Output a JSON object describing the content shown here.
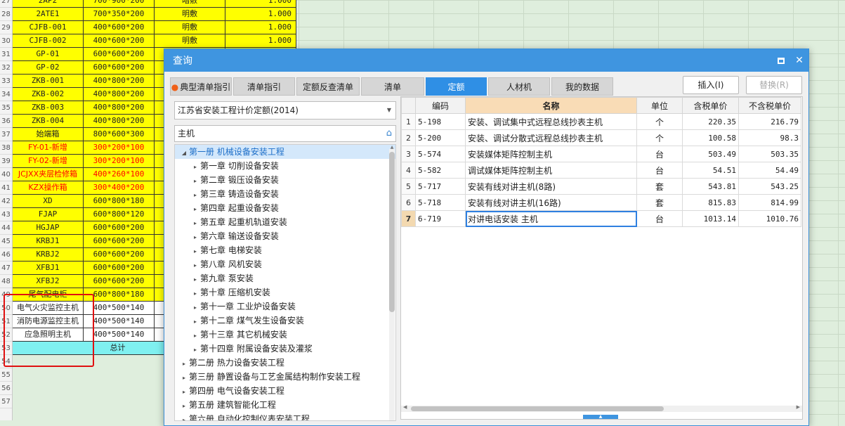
{
  "spreadsheet": {
    "row_numbers": [
      "27",
      "28",
      "29",
      "30",
      "31",
      "32",
      "33",
      "34",
      "35",
      "36",
      "37",
      "38",
      "39",
      "40",
      "41",
      "42",
      "43",
      "44",
      "45",
      "46",
      "47",
      "48",
      "49",
      "50",
      "51",
      "52",
      "53",
      "54",
      "55",
      "56",
      "57"
    ],
    "rows": [
      {
        "a": "2AP2",
        "b": "700*900*200",
        "c": "暗敷",
        "d": "1.000",
        "style": "yel"
      },
      {
        "a": "2ATE1",
        "b": "700*350*200",
        "c": "明敷",
        "d": "1.000",
        "style": "yel"
      },
      {
        "a": "CJFB-001",
        "b": "400*600*200",
        "c": "明敷",
        "d": "1.000",
        "style": "yel"
      },
      {
        "a": "CJFB-002",
        "b": "400*600*200",
        "c": "明敷",
        "d": "1.000",
        "style": "yel"
      },
      {
        "a": "GP-01",
        "b": "600*600*200",
        "c": "",
        "d": "",
        "style": "yel"
      },
      {
        "a": "GP-02",
        "b": "600*600*200",
        "c": "",
        "d": "",
        "style": "yel"
      },
      {
        "a": "ZKB-001",
        "b": "400*800*200",
        "c": "",
        "d": "",
        "style": "yel"
      },
      {
        "a": "ZKB-002",
        "b": "400*800*200",
        "c": "",
        "d": "",
        "style": "yel"
      },
      {
        "a": "ZKB-003",
        "b": "400*800*200",
        "c": "",
        "d": "",
        "style": "yel"
      },
      {
        "a": "ZKB-004",
        "b": "400*800*200",
        "c": "",
        "d": "",
        "style": "yel"
      },
      {
        "a": "始端箱",
        "b": "800*600*300",
        "c": "",
        "d": "",
        "style": "yel"
      },
      {
        "a": "FY-01-新增",
        "b": "300*200*100",
        "c": "",
        "d": "",
        "style": "yel red"
      },
      {
        "a": "FY-02-新增",
        "b": "300*200*100",
        "c": "",
        "d": "",
        "style": "yel red"
      },
      {
        "a": "JCJXX夹层检修箱",
        "b": "400*260*100",
        "c": "",
        "d": "",
        "style": "yel red"
      },
      {
        "a": "KZX操作箱",
        "b": "300*400*200",
        "c": "",
        "d": "",
        "style": "yel red"
      },
      {
        "a": "XD",
        "b": "600*800*180",
        "c": "",
        "d": "",
        "style": "yel"
      },
      {
        "a": "FJAP",
        "b": "600*800*120",
        "c": "",
        "d": "",
        "style": "yel"
      },
      {
        "a": "HGJAP",
        "b": "600*600*200",
        "c": "",
        "d": "",
        "style": "yel"
      },
      {
        "a": "KRBJ1",
        "b": "600*600*200",
        "c": "",
        "d": "",
        "style": "yel"
      },
      {
        "a": "KRBJ2",
        "b": "600*600*200",
        "c": "",
        "d": "",
        "style": "yel"
      },
      {
        "a": "XFBJ1",
        "b": "600*600*200",
        "c": "",
        "d": "",
        "style": "yel"
      },
      {
        "a": "XFBJ2",
        "b": "600*600*200",
        "c": "",
        "d": "",
        "style": "yel"
      },
      {
        "a": "尾气配电柜",
        "b": "600*800*180",
        "c": "",
        "d": "",
        "style": "yel"
      },
      {
        "a": "电气火灾监控主机",
        "b": "400*500*140",
        "c": "",
        "d": "",
        "style": "wht"
      },
      {
        "a": "消防电源监控主机",
        "b": "400*500*140",
        "c": "",
        "d": "",
        "style": "wht"
      },
      {
        "a": "应急照明主机",
        "b": "400*500*140",
        "c": "",
        "d": "",
        "style": "wht"
      }
    ],
    "total_label": "总计"
  },
  "dialog": {
    "title": "查询",
    "tabs": [
      {
        "label": "典型清单指引",
        "active": false
      },
      {
        "label": "清单指引",
        "active": false
      },
      {
        "label": "定额反查清单",
        "active": false
      },
      {
        "label": "清单",
        "active": false
      },
      {
        "label": "定额",
        "active": true
      },
      {
        "label": "人材机",
        "active": false
      },
      {
        "label": "我的数据",
        "active": false
      }
    ],
    "insert_label": "插入(I)",
    "replace_label": "替换(R)",
    "quota_selected": "江苏省安装工程计价定额(2014)",
    "search_value": "主机",
    "tree": [
      {
        "label": "第一册 机械设备安装工程",
        "level": 0,
        "expanded": true,
        "selected": true
      },
      {
        "label": "第一章 切削设备安装",
        "level": 1
      },
      {
        "label": "第二章 锻压设备安装",
        "level": 1
      },
      {
        "label": "第三章 铸造设备安装",
        "level": 1
      },
      {
        "label": "第四章 起重设备安装",
        "level": 1
      },
      {
        "label": "第五章 起重机轨道安装",
        "level": 1
      },
      {
        "label": "第六章 输送设备安装",
        "level": 1
      },
      {
        "label": "第七章 电梯安装",
        "level": 1
      },
      {
        "label": "第八章 风机安装",
        "level": 1
      },
      {
        "label": "第九章 泵安装",
        "level": 1
      },
      {
        "label": "第十章 压缩机安装",
        "level": 1
      },
      {
        "label": "第十一章 工业炉设备安装",
        "level": 1
      },
      {
        "label": "第十二章 煤气发生设备安装",
        "level": 1
      },
      {
        "label": "第十三章 其它机械安装",
        "level": 1
      },
      {
        "label": "第十四章 附属设备安装及灌浆",
        "level": 1
      },
      {
        "label": "第二册 热力设备安装工程",
        "level": 0
      },
      {
        "label": "第三册 静置设备与工艺金属结构制作安装工程",
        "level": 0
      },
      {
        "label": "第四册 电气设备安装工程",
        "level": 0
      },
      {
        "label": "第五册 建筑智能化工程",
        "level": 0
      },
      {
        "label": "第六册 自动化控制仪表安装工程",
        "level": 0
      }
    ],
    "grid": {
      "headers": {
        "code": "编码",
        "name": "名称",
        "unit": "单位",
        "tax_price": "含税单价",
        "notax_price": "不含税单价"
      },
      "rows": [
        {
          "idx": "1",
          "code": "5-198",
          "name": "安装、调试集中式远程总线抄表主机",
          "unit": "个",
          "tax_price": "220.35",
          "notax_price": "216.79"
        },
        {
          "idx": "2",
          "code": "5-200",
          "name": "安装、调试分散式远程总线抄表主机",
          "unit": "个",
          "tax_price": "100.58",
          "notax_price": "98.3"
        },
        {
          "idx": "3",
          "code": "5-574",
          "name": "安装媒体矩阵控制主机",
          "unit": "台",
          "tax_price": "503.49",
          "notax_price": "503.35"
        },
        {
          "idx": "4",
          "code": "5-582",
          "name": "调试媒体矩阵控制主机",
          "unit": "台",
          "tax_price": "54.51",
          "notax_price": "54.49"
        },
        {
          "idx": "5",
          "code": "5-717",
          "name": "安装有线对讲主机(8路)",
          "unit": "套",
          "tax_price": "543.81",
          "notax_price": "543.25"
        },
        {
          "idx": "6",
          "code": "5-718",
          "name": "安装有线对讲主机(16路)",
          "unit": "套",
          "tax_price": "815.83",
          "notax_price": "814.99"
        },
        {
          "idx": "7",
          "code": "6-719",
          "name": "对讲电话安装 主机",
          "unit": "台",
          "tax_price": "1013.14",
          "notax_price": "1010.76"
        }
      ],
      "current_row": "7"
    }
  },
  "colors": {
    "title_bar": "#3f95e0",
    "active_tab": "#2f8fe5",
    "highlight_yellow": "#ffff00",
    "total_cyan": "#7ff0f0",
    "annotation_red": "#e01010"
  }
}
